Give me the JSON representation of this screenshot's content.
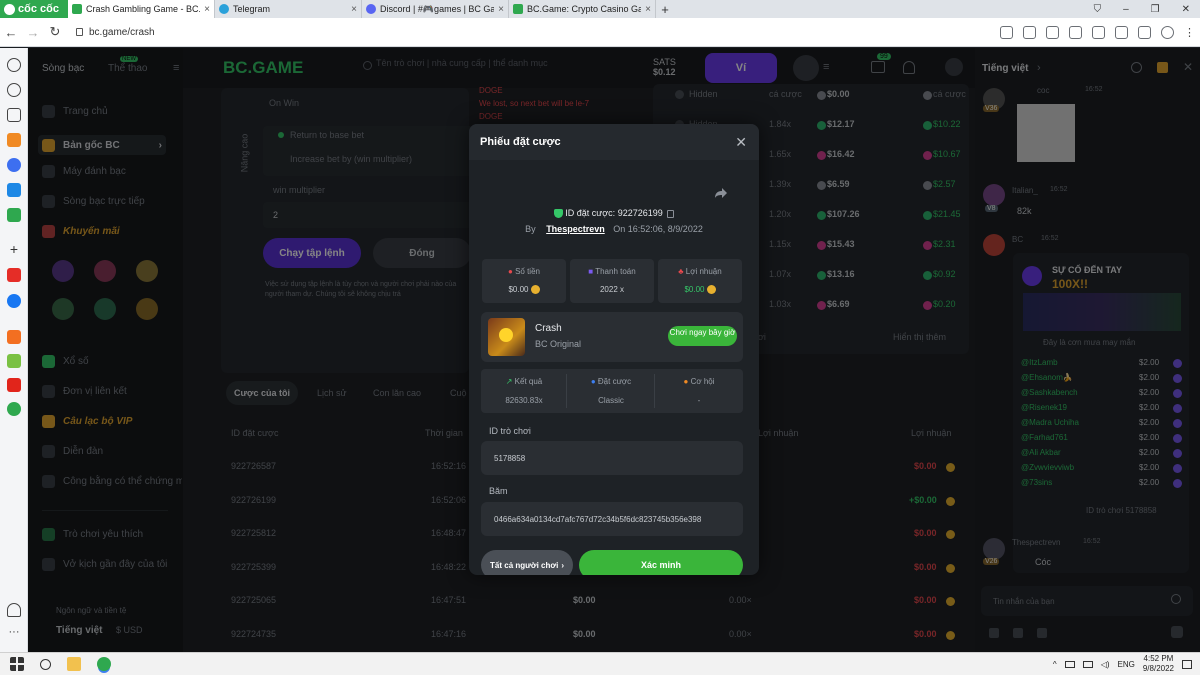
{
  "browser": {
    "brand": "cốc cốc",
    "tabs": [
      {
        "title": "Crash Gambling Game - BC.G",
        "active": true,
        "fav_color": "#2fa84f"
      },
      {
        "title": "Telegram",
        "active": false,
        "fav_color": "#2aa1da"
      },
      {
        "title": "Discord | #🎮games | BC Ga",
        "active": false,
        "fav_color": "#5865f2"
      },
      {
        "title": "BC.Game: Crypto Casino Gam",
        "active": false,
        "fav_color": "#2fa84f"
      }
    ],
    "url": "bc.game/crash"
  },
  "leftnav": {
    "sports_tab": "Sòng bạc",
    "sports_tab2": "Thể thao",
    "new_badge": "NEW",
    "items": [
      {
        "label": "Trang chủ",
        "style": "normal"
      },
      {
        "label": "Bản gốc BC",
        "style": "bold"
      },
      {
        "label": "Máy đánh bạc",
        "style": "normal"
      },
      {
        "label": "Sòng bạc trực tiếp",
        "style": "normal"
      },
      {
        "label": "Khuyến mãi",
        "style": "gold"
      },
      {
        "label": "Xổ số",
        "style": "normal"
      },
      {
        "label": "Đơn vị liên kết",
        "style": "normal"
      },
      {
        "label": "Câu lạc bộ VIP",
        "style": "gold"
      },
      {
        "label": "Diễn đàn",
        "style": "normal"
      },
      {
        "label": "Công bằng có thể chứng minh",
        "style": "normal"
      },
      {
        "label": "Trò chơi yêu thích",
        "style": "normal"
      },
      {
        "label": "Vở kịch gần đây của tôi",
        "style": "normal"
      }
    ],
    "lang_label": "Ngôn ngữ và tiền tệ",
    "lang_value": "Tiếng việt",
    "currency": "$ USD"
  },
  "topbar": {
    "logo": "BC.GAME",
    "search_placeholder": "Tên trò chơi | nhà cung cấp | thể danh mục",
    "sats_label": "SATS",
    "sats_value": "$0.12",
    "wallet": "Ví",
    "notif_count": "99"
  },
  "script_panel": {
    "advanced": "Nâng cao",
    "on_win": "On Win",
    "return_base": "Return to base bet",
    "increase_by": "Increase bet by (win multiplier)",
    "win_multiplier_label": "win multiplier",
    "win_multiplier_value": "2",
    "run_script": "Chạy tập lệnh",
    "close": "Đóng",
    "log_lines": [
      "DOGE",
      "We lost, so next bet will be le-7",
      "DOGE"
    ],
    "disclaimer": "Việc sử dụng tập lệnh là tùy chọn và người chơi phải nào của người tham dự. Chúng tôi sẽ không chịu trá"
  },
  "players": {
    "rows": [
      {
        "name": "Hidden",
        "mult": "cá cược",
        "bet": "$0.00",
        "profit": "cá cược"
      },
      {
        "name": "Hidden",
        "mult": "1.84x",
        "bet": "$12.17",
        "profit": "$10.22"
      },
      {
        "name": "Hidden",
        "mult": "1.65x",
        "bet": "$16.42",
        "profit": "$10.67"
      },
      {
        "name": "",
        "mult": "1.39x",
        "bet": "$6.59",
        "profit": "$2.57"
      },
      {
        "name": "",
        "mult": "1.20x",
        "bet": "$107.26",
        "profit": "$21.45"
      },
      {
        "name": "",
        "mult": "1.15x",
        "bet": "$15.43",
        "profit": "$2.31"
      },
      {
        "name": "",
        "mult": "1.07x",
        "bet": "$13.16",
        "profit": "$0.92"
      },
      {
        "name": "",
        "mult": "1.03x",
        "bet": "$6.69",
        "profit": "$0.20"
      }
    ],
    "show_more": "Hiển thị thêm",
    "partial_label": "ơi"
  },
  "history": {
    "tabs": [
      "Cược của tôi",
      "Lịch sử",
      "Con lăn cao",
      "Cuộ"
    ],
    "cols": [
      "ID đặt cược",
      "Thời gian",
      "Lợi nhuận",
      "Lợi nhuận"
    ],
    "rows": [
      {
        "id": "922726587",
        "time": "16:52:16",
        "bet": "",
        "mult": "",
        "profit": "$0.00",
        "profit_class": "dn"
      },
      {
        "id": "922726199",
        "time": "16:52:06",
        "bet": "",
        "mult": "",
        "profit": "+$0.00",
        "profit_class": "up"
      },
      {
        "id": "922725812",
        "time": "16:48:47",
        "bet": "",
        "mult": "",
        "profit": "$0.00",
        "profit_class": "dn"
      },
      {
        "id": "922725399",
        "time": "16:48:22",
        "bet": "",
        "mult": "",
        "profit": "$0.00",
        "profit_class": "dn"
      },
      {
        "id": "922725065",
        "time": "16:47:51",
        "bet": "$0.00",
        "mult": "0.00×",
        "profit": "$0.00",
        "profit_class": "dn"
      },
      {
        "id": "922724735",
        "time": "16:47:16",
        "bet": "$0.00",
        "mult": "0.00×",
        "profit": "$0.00",
        "profit_class": "dn"
      }
    ]
  },
  "modal": {
    "title": "Phiếu đặt cược",
    "bet_id_label": "ID đặt cược:",
    "bet_id": "922726199",
    "by_label": "By",
    "username": "Thespectrevn",
    "on_label": "On",
    "datetime": "16:52:06, 8/9/2022",
    "stats": [
      {
        "label": "Số tiền",
        "value": "$0.00",
        "coin": true
      },
      {
        "label": "Thanh toán",
        "value": "2022 x",
        "coin": false
      },
      {
        "label": "Lợi nhuận",
        "value": "$0.00",
        "coin": true
      }
    ],
    "game_name": "Crash",
    "game_provider": "BC Original",
    "play_now": "Chơi ngay bây giờ",
    "details": [
      {
        "label": "Kết quả",
        "value": "82630.83x"
      },
      {
        "label": "Đặt cược",
        "value": "Classic"
      },
      {
        "label": "Cơ hội",
        "value": "-"
      }
    ],
    "game_id_label": "ID trò chơi",
    "game_id": "5178858",
    "hash_label": "Băm",
    "hash": "0466a634a0134cd7afc767d72c34b5f6dc823745b356e398",
    "all_players": "Tất cả người chơi",
    "verify": "Xác minh"
  },
  "chat": {
    "lang": "Tiếng việt",
    "msgs": [
      {
        "user": "coc",
        "time": "16:52",
        "text": ""
      },
      {
        "user": "Italian_",
        "time": "16:52",
        "text": "82k"
      },
      {
        "user": "BC",
        "time": "16:52",
        "text": ""
      }
    ],
    "event_title": "SỰ CỐ ĐẾN TAY",
    "event_sub": "100X!!",
    "rain_text": "Đây là cơn mưa may mắn",
    "rain": [
      {
        "name": "@ItzLamb",
        "amt": "$2.00"
      },
      {
        "name": "@Ehsanom🍌",
        "amt": "$2.00"
      },
      {
        "name": "@Sashkabench",
        "amt": "$2.00"
      },
      {
        "name": "@Risenek19",
        "amt": "$2.00"
      },
      {
        "name": "@Madra Uchiha",
        "amt": "$2.00"
      },
      {
        "name": "@Farhad761",
        "amt": "$2.00"
      },
      {
        "name": "@Ali Akbar",
        "amt": "$2.00"
      },
      {
        "name": "@Zvwvievviwb",
        "amt": "$2.00"
      },
      {
        "name": "@73sins",
        "amt": "$2.00"
      }
    ],
    "game_id_link": "ID trò chơi 5178858",
    "last_user": "Thespectrevn",
    "last_time": "16:52",
    "last_text": "Cóc",
    "input_placeholder": "Tin nhắn của bạn",
    "badges": [
      "V36",
      "V8",
      "V26"
    ]
  },
  "taskbar": {
    "lang": "ENG",
    "time": "4:52 PM",
    "date": "9/8/2022"
  }
}
